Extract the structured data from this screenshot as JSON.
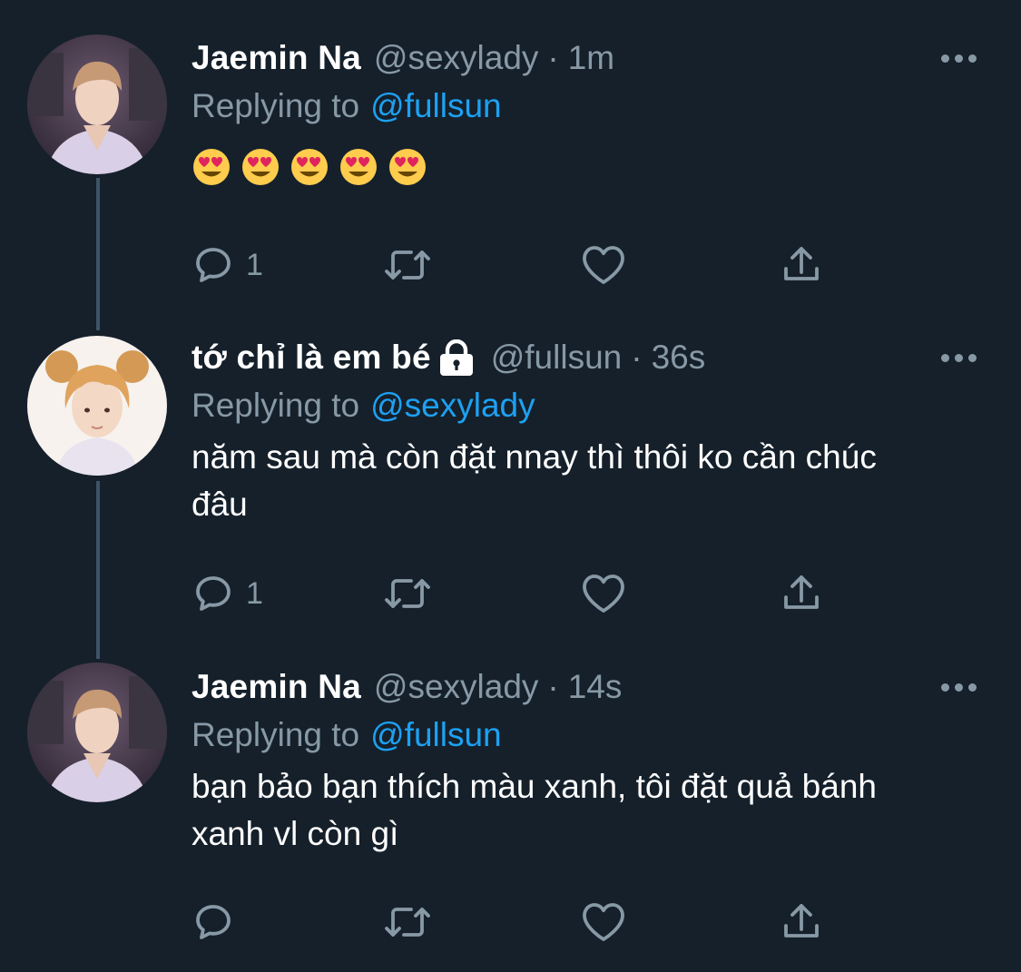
{
  "tweets": [
    {
      "display_name": "Jaemin Na",
      "handle": "@sexylady",
      "separator": "·",
      "time": "1m",
      "replying_prefix": "Replying to",
      "replying_to": "@fullsun",
      "text": "",
      "emoji": [
        "heart-eyes-emoji",
        "heart-eyes-emoji",
        "heart-eyes-emoji",
        "heart-eyes-emoji",
        "heart-eyes-emoji"
      ],
      "reply_count": "1",
      "locked": false
    },
    {
      "display_name": "tớ chỉ là em bé",
      "handle": "@fullsun",
      "separator": "·",
      "time": "36s",
      "replying_prefix": "Replying to",
      "replying_to": "@sexylady",
      "text": "năm sau mà còn đặt nnay thì thôi ko cần chúc đâu",
      "reply_count": "1",
      "locked": true
    },
    {
      "display_name": "Jaemin Na",
      "handle": "@sexylady",
      "separator": "·",
      "time": "14s",
      "replying_prefix": "Replying to",
      "replying_to": "@fullsun",
      "text": "bạn bảo bạn thích màu xanh, tôi đặt quả bánh xanh vl còn gì",
      "reply_count": "",
      "locked": false
    }
  ],
  "icons": {
    "reply": "reply-icon",
    "retweet": "retweet-icon",
    "like": "heart-icon",
    "share": "share-icon",
    "more": "more-icon",
    "lock": "lock-icon"
  },
  "colors": {
    "background": "#15202b",
    "text": "#ffffff",
    "secondary": "#8899a6",
    "link": "#1da1f2",
    "thread_line": "#3d5466"
  }
}
